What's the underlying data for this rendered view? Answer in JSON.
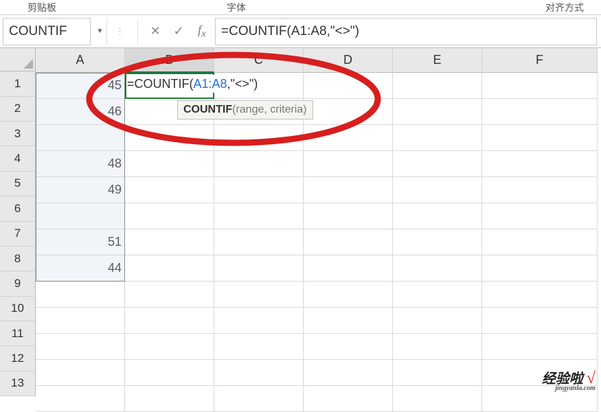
{
  "ribbon": {
    "group1": "剪贴板",
    "group2": "字体",
    "group3": "对齐方式"
  },
  "nameBox": {
    "value": "COUNTIF"
  },
  "formulaBar": {
    "text": "=COUNTIF(A1:A8,\"<>\")"
  },
  "columns": [
    "A",
    "B",
    "C",
    "D",
    "E",
    "F"
  ],
  "rows": [
    "1",
    "2",
    "3",
    "4",
    "5",
    "6",
    "7",
    "8",
    "9",
    "10",
    "11",
    "12",
    "13"
  ],
  "cells": {
    "A1": "45",
    "A2": "46",
    "A4": "48",
    "A5": "49",
    "A7": "51",
    "A8": "44"
  },
  "editingFormula": {
    "prefix": "=COUNTIF(",
    "ref": "A1:A8",
    "suffix": ",\"<>\")"
  },
  "tooltip": {
    "bold": "COUNTIF",
    "rest": "(range, criteria)"
  },
  "activeCol": "B",
  "watermark": {
    "main": "经验啦",
    "check": "√",
    "sub": "jingyanla.com"
  },
  "chart_data": null
}
